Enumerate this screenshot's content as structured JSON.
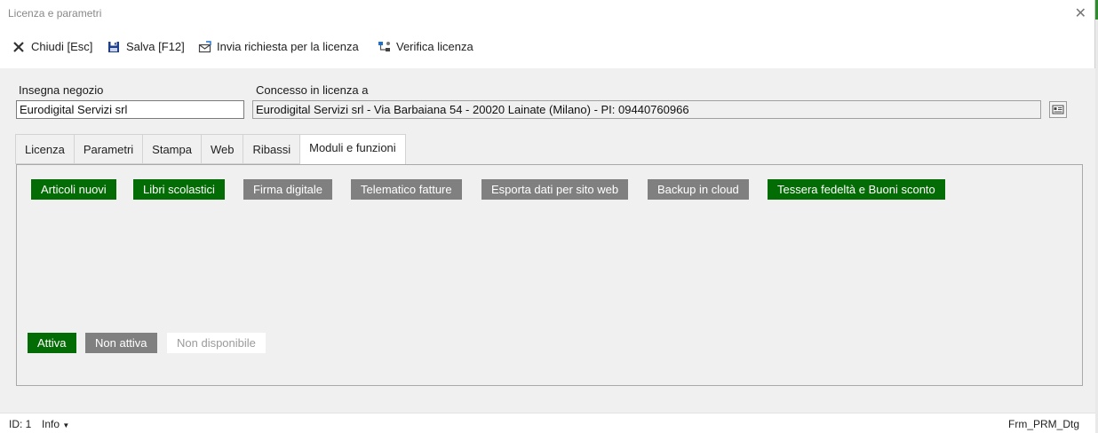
{
  "window": {
    "title": "Licenza e parametri"
  },
  "toolbar": {
    "close_label": "Chiudi [Esc]",
    "save_label": "Salva [F12]",
    "send_label": "Invia richiesta per la licenza",
    "verify_label": "Verifica licenza"
  },
  "form": {
    "shop_label": "Insegna negozio",
    "shop_value": "Eurodigital Servizi srl",
    "licensed_label": "Concesso in licenza a",
    "licensed_value": "Eurodigital Servizi srl - Via Barbaiana 54 - 20020 Lainate (Milano) - PI: 09440760966"
  },
  "tabs": [
    "Licenza",
    "Parametri",
    "Stampa",
    "Web",
    "Ribassi",
    "Moduli e funzioni"
  ],
  "modules": [
    {
      "label": "Articoli nuovi",
      "state": "active"
    },
    {
      "label": "Libri scolastici",
      "state": "active"
    },
    {
      "label": "Firma digitale",
      "state": "inactive"
    },
    {
      "label": "Telematico fatture",
      "state": "inactive"
    },
    {
      "label": "Esporta dati per sito web",
      "state": "inactive"
    },
    {
      "label": "Backup in cloud",
      "state": "inactive"
    },
    {
      "label": "Tessera fedeltà e Buoni sconto",
      "state": "active"
    }
  ],
  "legend": {
    "active": "Attiva",
    "inactive": "Non attiva",
    "unavailable": "Non disponibile"
  },
  "colors": {
    "active": "#046c04",
    "inactive": "#808080",
    "unavailable": "#ffffff"
  },
  "status": {
    "id": "ID: 1",
    "info": "Info",
    "form_name": "Frm_PRM_Dtg"
  }
}
